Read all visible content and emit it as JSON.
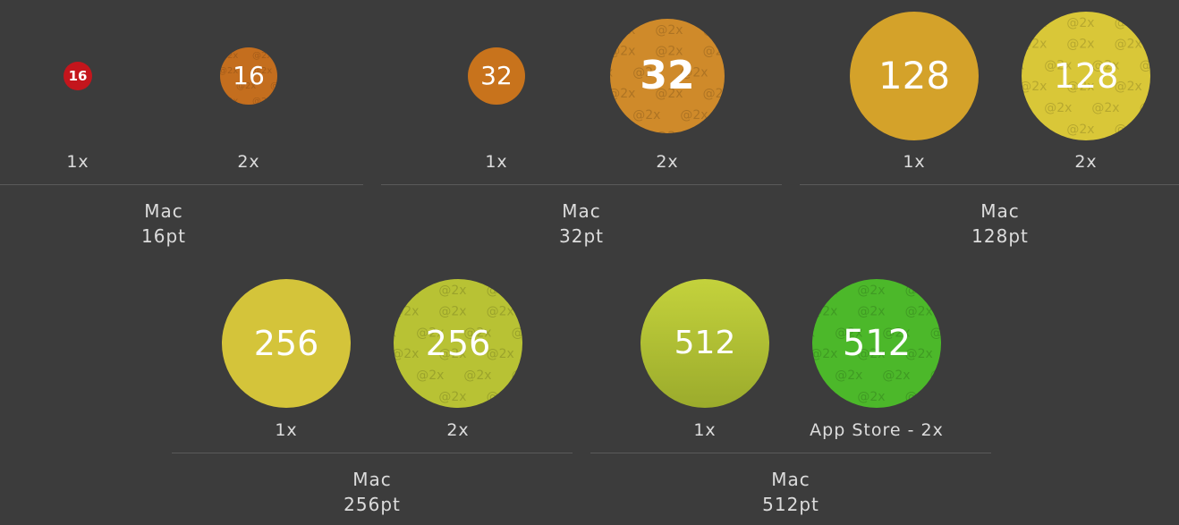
{
  "groups": [
    {
      "platform": "Mac",
      "size": "16pt",
      "slots": [
        {
          "label": "1x",
          "number": "16",
          "icon": "icon-16-1x",
          "color": "#c4151c",
          "watermark": false
        },
        {
          "label": "2x",
          "number": "16",
          "icon": "icon-16-2x",
          "color": "#c46e1e",
          "watermark": true
        }
      ]
    },
    {
      "platform": "Mac",
      "size": "32pt",
      "slots": [
        {
          "label": "1x",
          "number": "32",
          "icon": "icon-32-1x",
          "color": "#c8731c",
          "watermark": false
        },
        {
          "label": "2x",
          "number": "32",
          "icon": "icon-32-2x",
          "color": "#cf8a2a",
          "watermark": true
        }
      ]
    },
    {
      "platform": "Mac",
      "size": "128pt",
      "slots": [
        {
          "label": "1x",
          "number": "128",
          "icon": "icon-128-1x",
          "color": "#d4a22a",
          "watermark": false
        },
        {
          "label": "2x",
          "number": "128",
          "icon": "icon-128-2x",
          "color": "#d9c738",
          "watermark": true
        }
      ]
    },
    {
      "platform": "Mac",
      "size": "256pt",
      "slots": [
        {
          "label": "1x",
          "number": "256",
          "icon": "icon-256-1x",
          "color": "#d4c43a",
          "watermark": false
        },
        {
          "label": "2x",
          "number": "256",
          "icon": "icon-256-2x",
          "color": "#b8c234",
          "watermark": true
        }
      ]
    },
    {
      "platform": "Mac",
      "size": "512pt",
      "slots": [
        {
          "label": "1x",
          "number": "512",
          "icon": "icon-512-1x",
          "color": "#b3c235",
          "watermark": false
        },
        {
          "label": "App Store - 2x",
          "number": "512",
          "icon": "icon-512-appstore",
          "color": "#4cb82a",
          "watermark": true
        }
      ]
    }
  ],
  "watermark_text": "@2x"
}
